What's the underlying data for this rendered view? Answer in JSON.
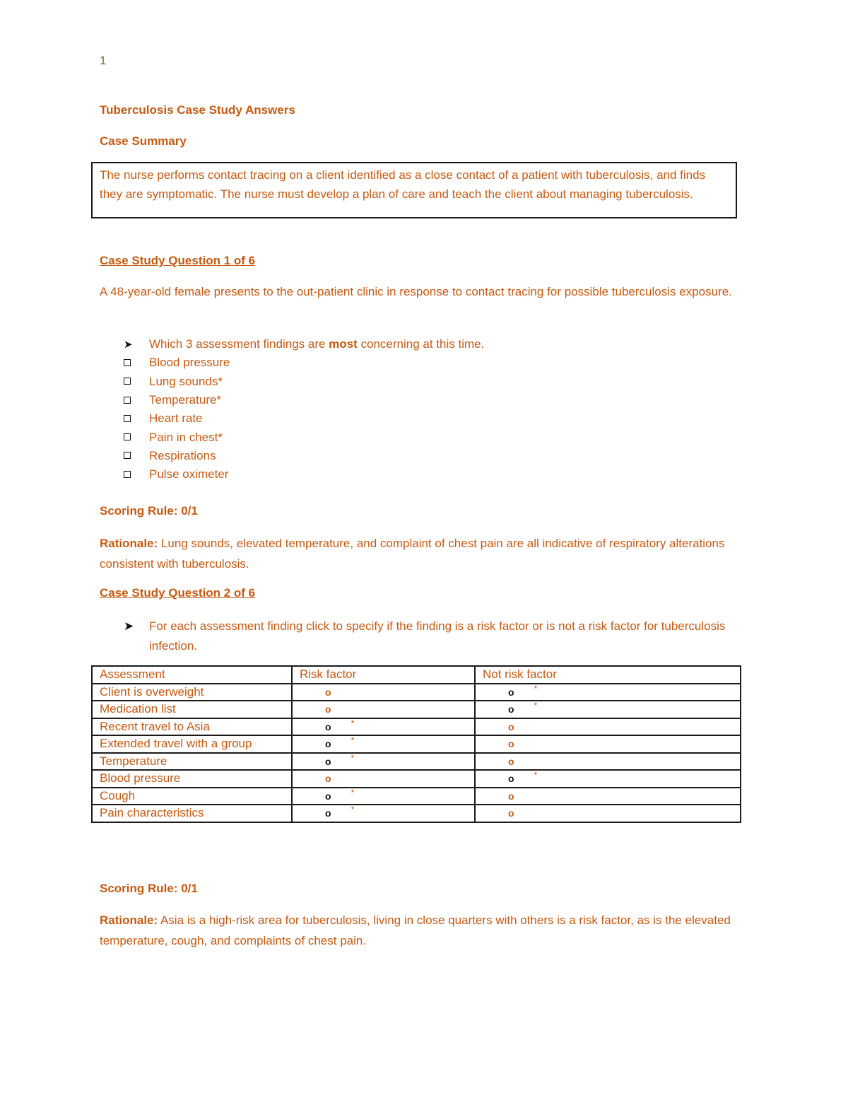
{
  "page_number": "1",
  "title": "Tuberculosis Case Study Answers",
  "case_summary": {
    "heading": "Case Summary",
    "text": "The nurse performs contact tracing on a client identified as a close contact of a patient with tuberculosis, and finds they are symptomatic. The nurse must develop a plan of care and teach the client about managing tuberculosis."
  },
  "q1": {
    "heading": "Case Study Question 1 of 6",
    "stem": "A 48-year-old female presents to the out-patient clinic in response to contact tracing for possible tuberculosis exposure.",
    "instruction_prefix": "Which 3 assessment findings are ",
    "instruction_bold": "most",
    "instruction_suffix": " concerning at this time.",
    "options": [
      "Blood pressure",
      "Lung sounds*",
      "Temperature*",
      "Heart rate",
      "Pain in chest*",
      "Respirations",
      "Pulse oximeter"
    ],
    "scoring_rule": "Scoring Rule: 0/1",
    "rationale_label": "Rationale:",
    "rationale_text": " Lung sounds, elevated temperature, and complaint of chest pain are all indicative of respiratory alterations consistent with tuberculosis."
  },
  "q2": {
    "heading": "Case Study Question 2 of 6",
    "instruction": "For each assessment finding click to specify if the finding is a risk factor or is not a risk factor for tuberculosis infection.",
    "table": {
      "headers": [
        "Assessment",
        "Risk factor",
        "Not risk factor"
      ],
      "option_glyph": "o",
      "answer_mark": "*",
      "rows": [
        {
          "assessment": "Client is overweight",
          "answer": "Not risk factor"
        },
        {
          "assessment": "Medication list",
          "answer": "Not risk factor"
        },
        {
          "assessment": "Recent travel to Asia",
          "answer": "Risk factor"
        },
        {
          "assessment": "Extended travel with a group",
          "answer": "Risk factor"
        },
        {
          "assessment": "Temperature",
          "answer": "Risk factor"
        },
        {
          "assessment": "Blood pressure",
          "answer": "Not risk factor"
        },
        {
          "assessment": "Cough",
          "answer": "Risk factor"
        },
        {
          "assessment": "Pain characteristics",
          "answer": "Risk factor"
        }
      ]
    },
    "scoring_rule": "Scoring Rule: 0/1",
    "rationale_label": "Rationale:",
    "rationale_text": " Asia is a high-risk area for tuberculosis, living in close quarters with others is a risk factor, as is the elevated temperature, cough, and complaints of chest pain."
  },
  "colors": {
    "text": "#C55A11",
    "page_number": "#538135",
    "selected_option": "#111111"
  }
}
